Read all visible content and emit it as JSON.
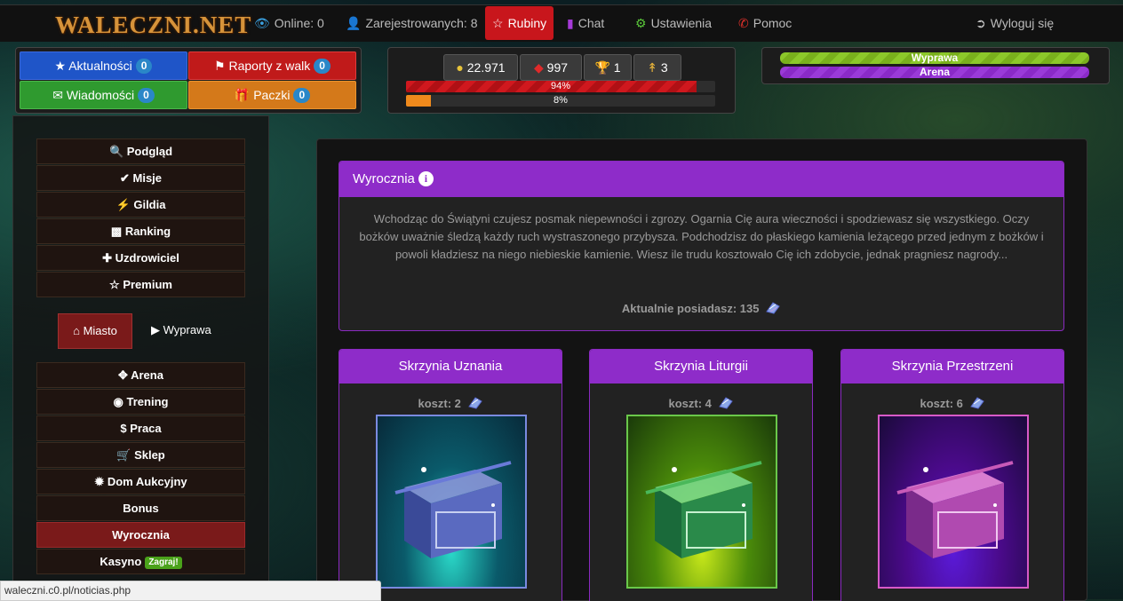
{
  "brand": {
    "logo": "WALECZNI.NET"
  },
  "topnav": {
    "online": "Online: 0",
    "registered": "Zarejestrowanych: 8",
    "rubiny": "Rubiny",
    "chat": "Chat",
    "settings": "Ustawienia",
    "help": "Pomoc",
    "logout": "Wyloguj się"
  },
  "quick": {
    "news": {
      "label": "Aktualności",
      "count": "0"
    },
    "reports": {
      "label": "Raporty z walk",
      "count": "0"
    },
    "messages": {
      "label": "Wiadomości",
      "count": "0"
    },
    "packages": {
      "label": "Paczki",
      "count": "0"
    }
  },
  "stats": {
    "gold": "22.971",
    "rubies": "997",
    "trophies": "1",
    "rank": "3"
  },
  "bars": {
    "health": {
      "label": "94%",
      "percent": 94
    },
    "exp": {
      "label": "8%",
      "percent": 8
    }
  },
  "status": {
    "expedition": "Wyprawa",
    "arena": "Arena"
  },
  "sidebar": {
    "top": [
      "Podgląd",
      "Misje",
      "Gildia",
      "Ranking",
      "Uzdrowiciel",
      "Premium"
    ],
    "tabs": {
      "city": "Miasto",
      "expedition": "Wyprawa"
    },
    "city": [
      "Arena",
      "Trening",
      "Praca",
      "Sklep",
      "Dom Aukcyjny",
      "Bonus",
      "Wyrocznia",
      "Kasyno"
    ],
    "casino_badge": "Zagraj!"
  },
  "oracle": {
    "title": "Wyrocznia",
    "description": "Wchodząc do Świątyni czujesz posmak niepewności i zgrozy. Ogarnia Cię aura wieczności i spodziewasz się wszystkiego. Oczy bożków uważnie śledzą każdy ruch wystraszonego przybysza. Podchodzisz do płaskiego kamienia leżącego przed jednym z bożków i powoli kładziesz na niego niebieskie kamienie. Wiesz ile trudu kosztowało Cię ich zdobycie, jednak pragniesz nagrody...",
    "owned": "Aktualnie posiadasz: 135"
  },
  "chests": [
    {
      "title": "Skrzynia Uznania",
      "cost": "koszt: 2",
      "color": "#3b55c8"
    },
    {
      "title": "Skrzynia Liturgii",
      "cost": "koszt: 4",
      "color": "#5ab02a"
    },
    {
      "title": "Skrzynia Przestrzeni",
      "cost": "koszt: 6",
      "color": "#a63ac8"
    }
  ],
  "statusbar": "waleczni.c0.pl/noticias.php",
  "colors": {
    "purple": "#8e2cc9",
    "red": "#c8161c",
    "blue": "#1f55c8",
    "green": "#2f9a2f",
    "orange": "#d4791a"
  }
}
